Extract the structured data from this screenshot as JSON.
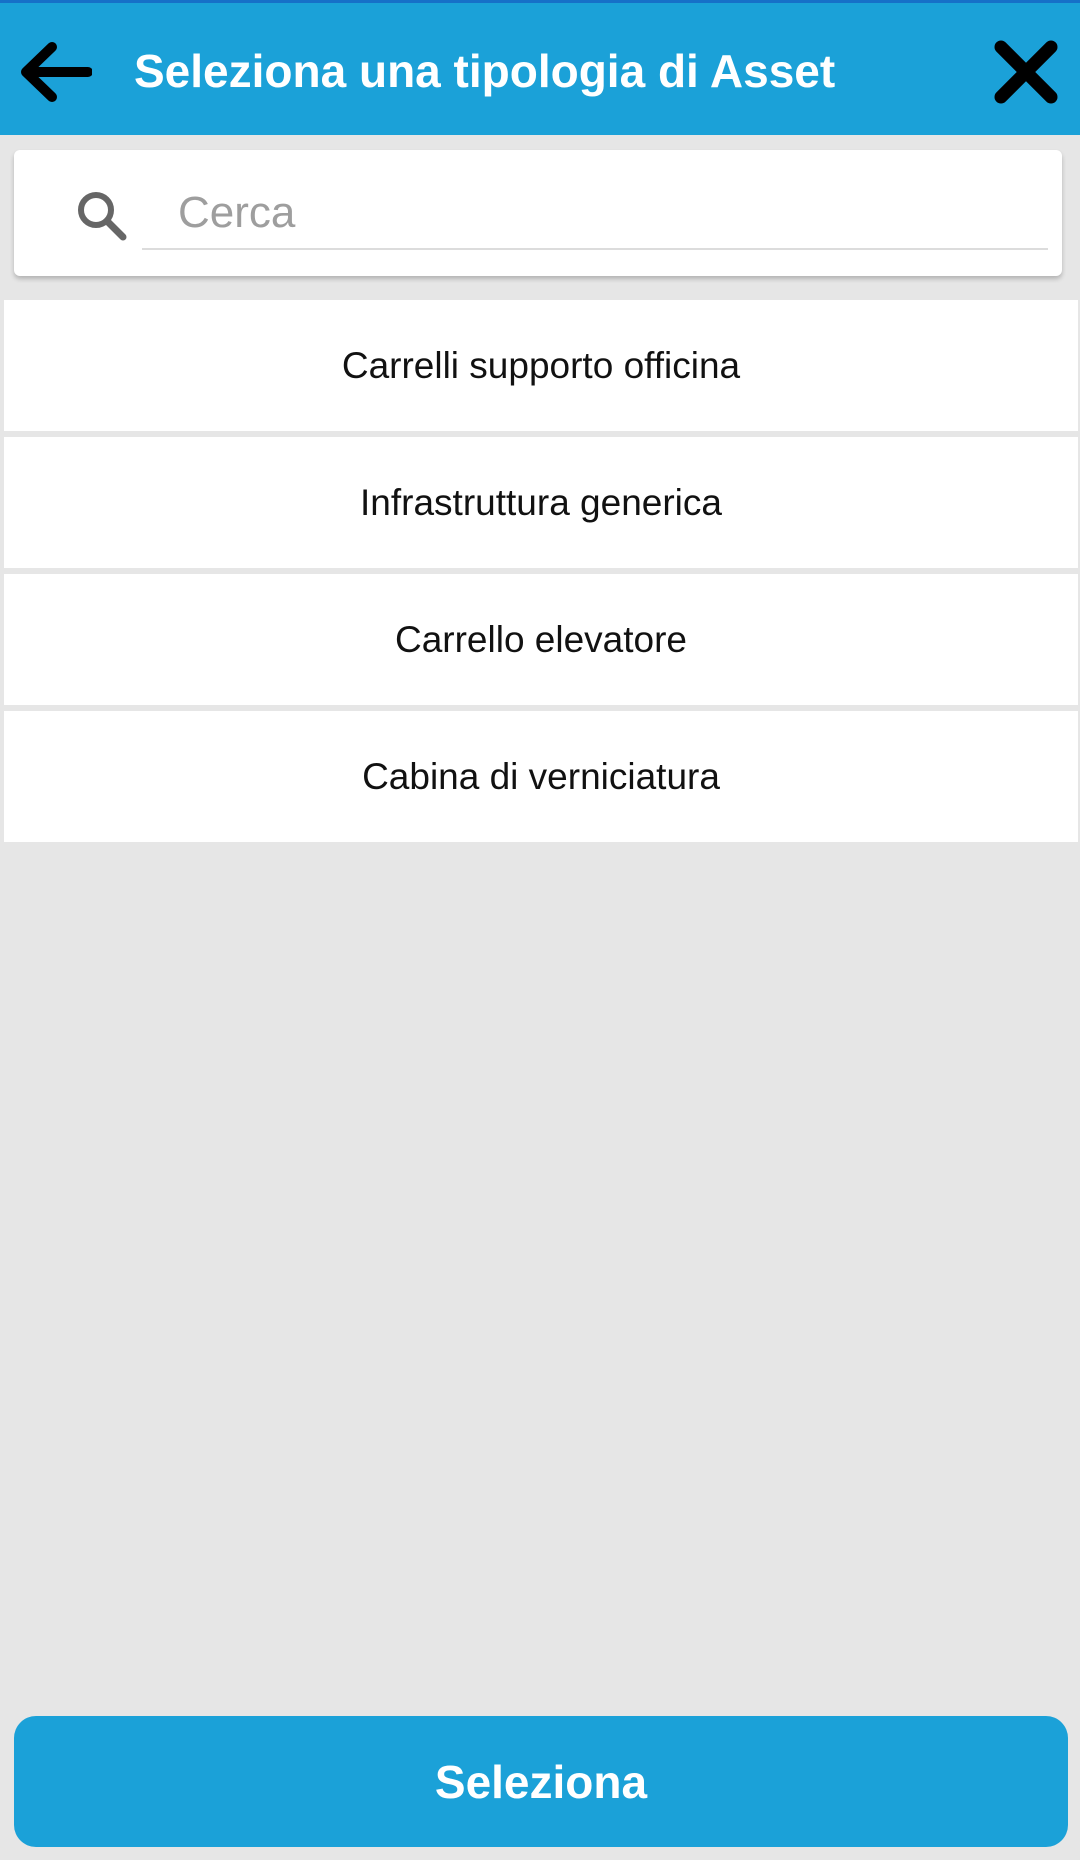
{
  "header": {
    "title": "Seleziona una tipologia di Asset",
    "back_icon": "arrow-left-icon",
    "close_icon": "close-icon",
    "background_color": "#1ba1d8"
  },
  "search": {
    "placeholder": "Cerca",
    "value": "",
    "icon": "search-icon"
  },
  "list": {
    "items": [
      {
        "label": "Carrelli supporto officina"
      },
      {
        "label": "Infrastruttura generica"
      },
      {
        "label": "Carrello elevatore"
      },
      {
        "label": "Cabina di verniciatura"
      }
    ]
  },
  "footer": {
    "select_label": "Seleziona",
    "button_color": "#1ba1d8"
  }
}
